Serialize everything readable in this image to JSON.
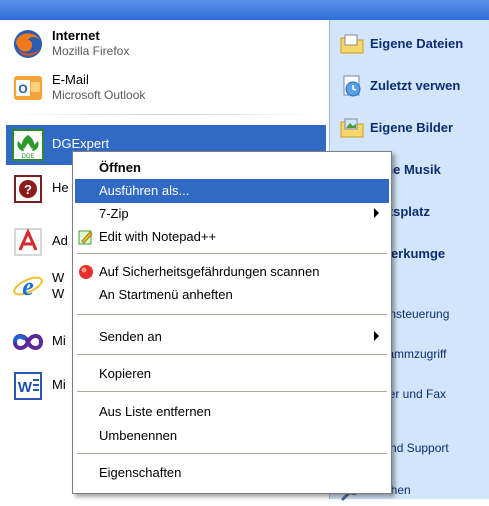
{
  "start_menu": {
    "pinned": [
      {
        "title": "Internet",
        "subtitle": "Mozilla Firefox"
      },
      {
        "title": "E-Mail",
        "subtitle": "Microsoft Outlook"
      }
    ],
    "programs": [
      {
        "label": "DGExpert",
        "icon": "dgexpert-icon"
      },
      {
        "label": "He",
        "icon": "help-icon"
      },
      {
        "label": "Ad",
        "icon": "adobe-reader-icon"
      },
      {
        "label1": "W",
        "label2": "W",
        "icon": "internet-explorer-icon"
      },
      {
        "label": "Mi",
        "icon": "visual-studio-icon"
      },
      {
        "label": "Mi",
        "icon": "word-icon"
      }
    ],
    "places": [
      "Eigene Dateien",
      "Zuletzt verwen",
      "Eigene Bilder",
      "gene Musik",
      "beitsplatz",
      "tzwerkumge",
      "stemsteuerung",
      "ogrammzugriff",
      "ucker und Fax",
      "fe und Support",
      "Suchen"
    ]
  },
  "context_menu": {
    "items": {
      "open": "Öffnen",
      "run_as": "Ausführen als...",
      "seven_zip": "7-Zip",
      "notepad": "Edit with Notepad++",
      "scan": "Auf Sicherheitsgefährdungen scannen",
      "pin": "An Startmenü anheften",
      "send_to": "Senden an",
      "copy": "Kopieren",
      "remove": "Aus Liste entfernen",
      "rename": "Umbenennen",
      "properties": "Eigenschaften"
    }
  },
  "colors": {
    "highlight": "#316ac5",
    "right_pane": "#d3e5fa",
    "top_bar": "#2f6fd9"
  }
}
